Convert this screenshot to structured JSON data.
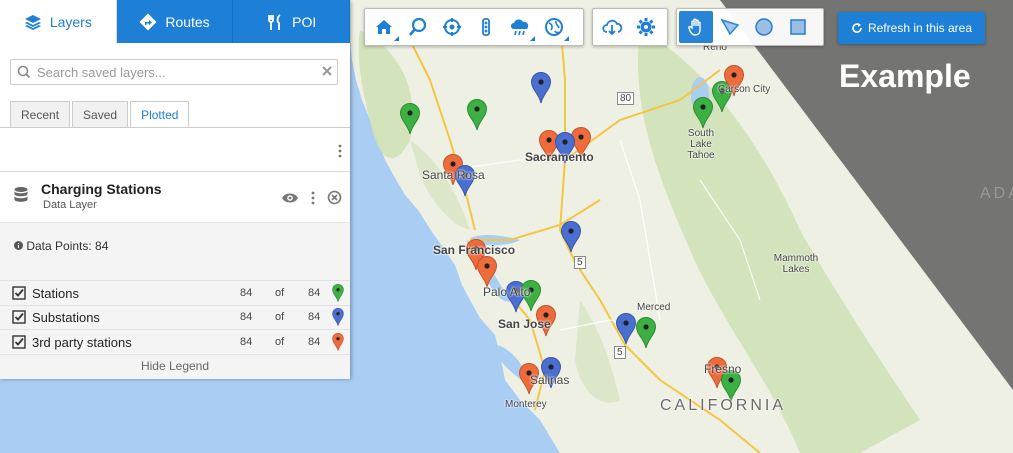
{
  "tabs": {
    "layers": "Layers",
    "routes": "Routes",
    "poi": "POI"
  },
  "search": {
    "placeholder": "Search saved layers..."
  },
  "sub_tabs": {
    "recent": "Recent",
    "saved": "Saved",
    "plotted": "Plotted"
  },
  "layer": {
    "title": "Charging Stations",
    "subtitle": "Data Layer",
    "data_points": "Data Points: 84"
  },
  "legend": {
    "items": [
      {
        "label": "Stations",
        "count": "84",
        "of": "of",
        "total": "84",
        "color": "#3db044"
      },
      {
        "label": "Substations",
        "count": "84",
        "of": "of",
        "total": "84",
        "color": "#4a6fd1"
      },
      {
        "label": "3rd party stations",
        "count": "84",
        "of": "of",
        "total": "84",
        "color": "#ee6b3b"
      }
    ],
    "hide_label": "Hide Legend"
  },
  "toolbar": {
    "refresh_label": "Refresh in this area"
  },
  "ribbon": {
    "text": "Example"
  },
  "map_labels": {
    "sacramento": "Sacramento",
    "santa_rosa": "Santa Rosa",
    "san_francisco": "San Francisco",
    "palo_alto": "Palo Alto",
    "san_jose": "San Jose",
    "salinas": "Salinas",
    "monterey": "Monterey",
    "merced": "Merced",
    "fresno": "Fresno",
    "reno": "Reno",
    "carson_city": "Carson City",
    "south_lake_tahoe": "South Lake Tahoe",
    "mammoth_lakes": "Mammoth Lakes",
    "california": "CALIFORNIA",
    "nevada_fragment": "ADA",
    "highway_80": "80",
    "highway_5a": "5",
    "highway_5b": "5"
  },
  "colors": {
    "accent": "#1e7fd6",
    "green": "#3db044",
    "blue": "#4a6fd1",
    "orange": "#ee6b3b",
    "land": "#eef0e4",
    "water": "#a9cdf3"
  },
  "markers": [
    {
      "color": "green"
    },
    {
      "color": "green"
    },
    {
      "color": "blue"
    },
    {
      "color": "green"
    },
    {
      "color": "orange"
    },
    {
      "color": "blue"
    },
    {
      "color": "orange"
    },
    {
      "color": "orange"
    },
    {
      "color": "blue"
    },
    {
      "color": "orange"
    },
    {
      "color": "green"
    },
    {
      "color": "orange"
    },
    {
      "color": "orange"
    },
    {
      "color": "blue"
    },
    {
      "color": "blue"
    },
    {
      "color": "green"
    },
    {
      "color": "orange"
    },
    {
      "color": "blue"
    },
    {
      "color": "orange"
    },
    {
      "color": "blue"
    },
    {
      "color": "green"
    },
    {
      "color": "orange"
    },
    {
      "color": "green"
    }
  ]
}
